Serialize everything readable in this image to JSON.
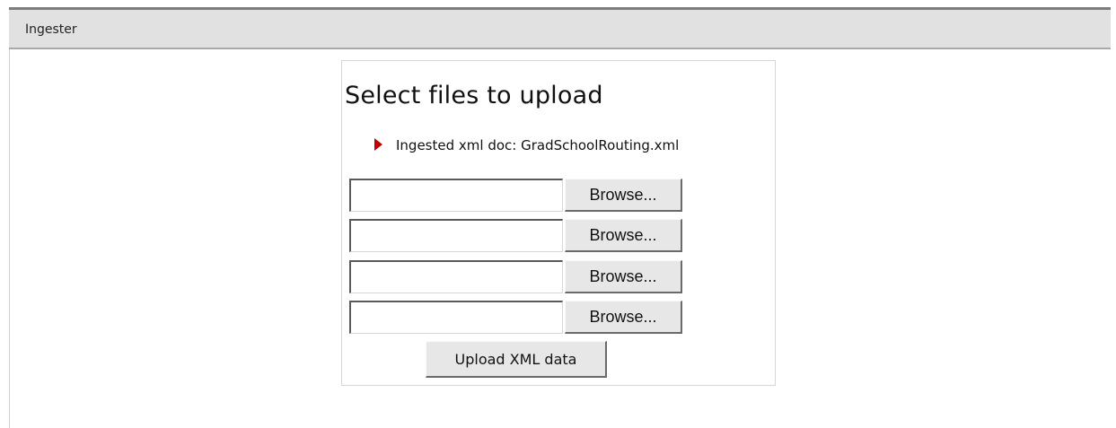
{
  "window": {
    "title": "Ingester"
  },
  "panel": {
    "heading": "Select files to upload",
    "status": {
      "icon": "red-triangle-arrow-icon",
      "text": "Ingested xml doc: GradSchoolRouting.xml"
    },
    "file_rows": [
      {
        "value": "",
        "browse_label": "Browse..."
      },
      {
        "value": "",
        "browse_label": "Browse..."
      },
      {
        "value": "",
        "browse_label": "Browse..."
      },
      {
        "value": "",
        "browse_label": "Browse..."
      }
    ],
    "upload_label": "Upload XML data"
  },
  "colors": {
    "titlebar": "#e2e1e1",
    "arrow": "#c00000",
    "button": "#e7e7e7"
  }
}
